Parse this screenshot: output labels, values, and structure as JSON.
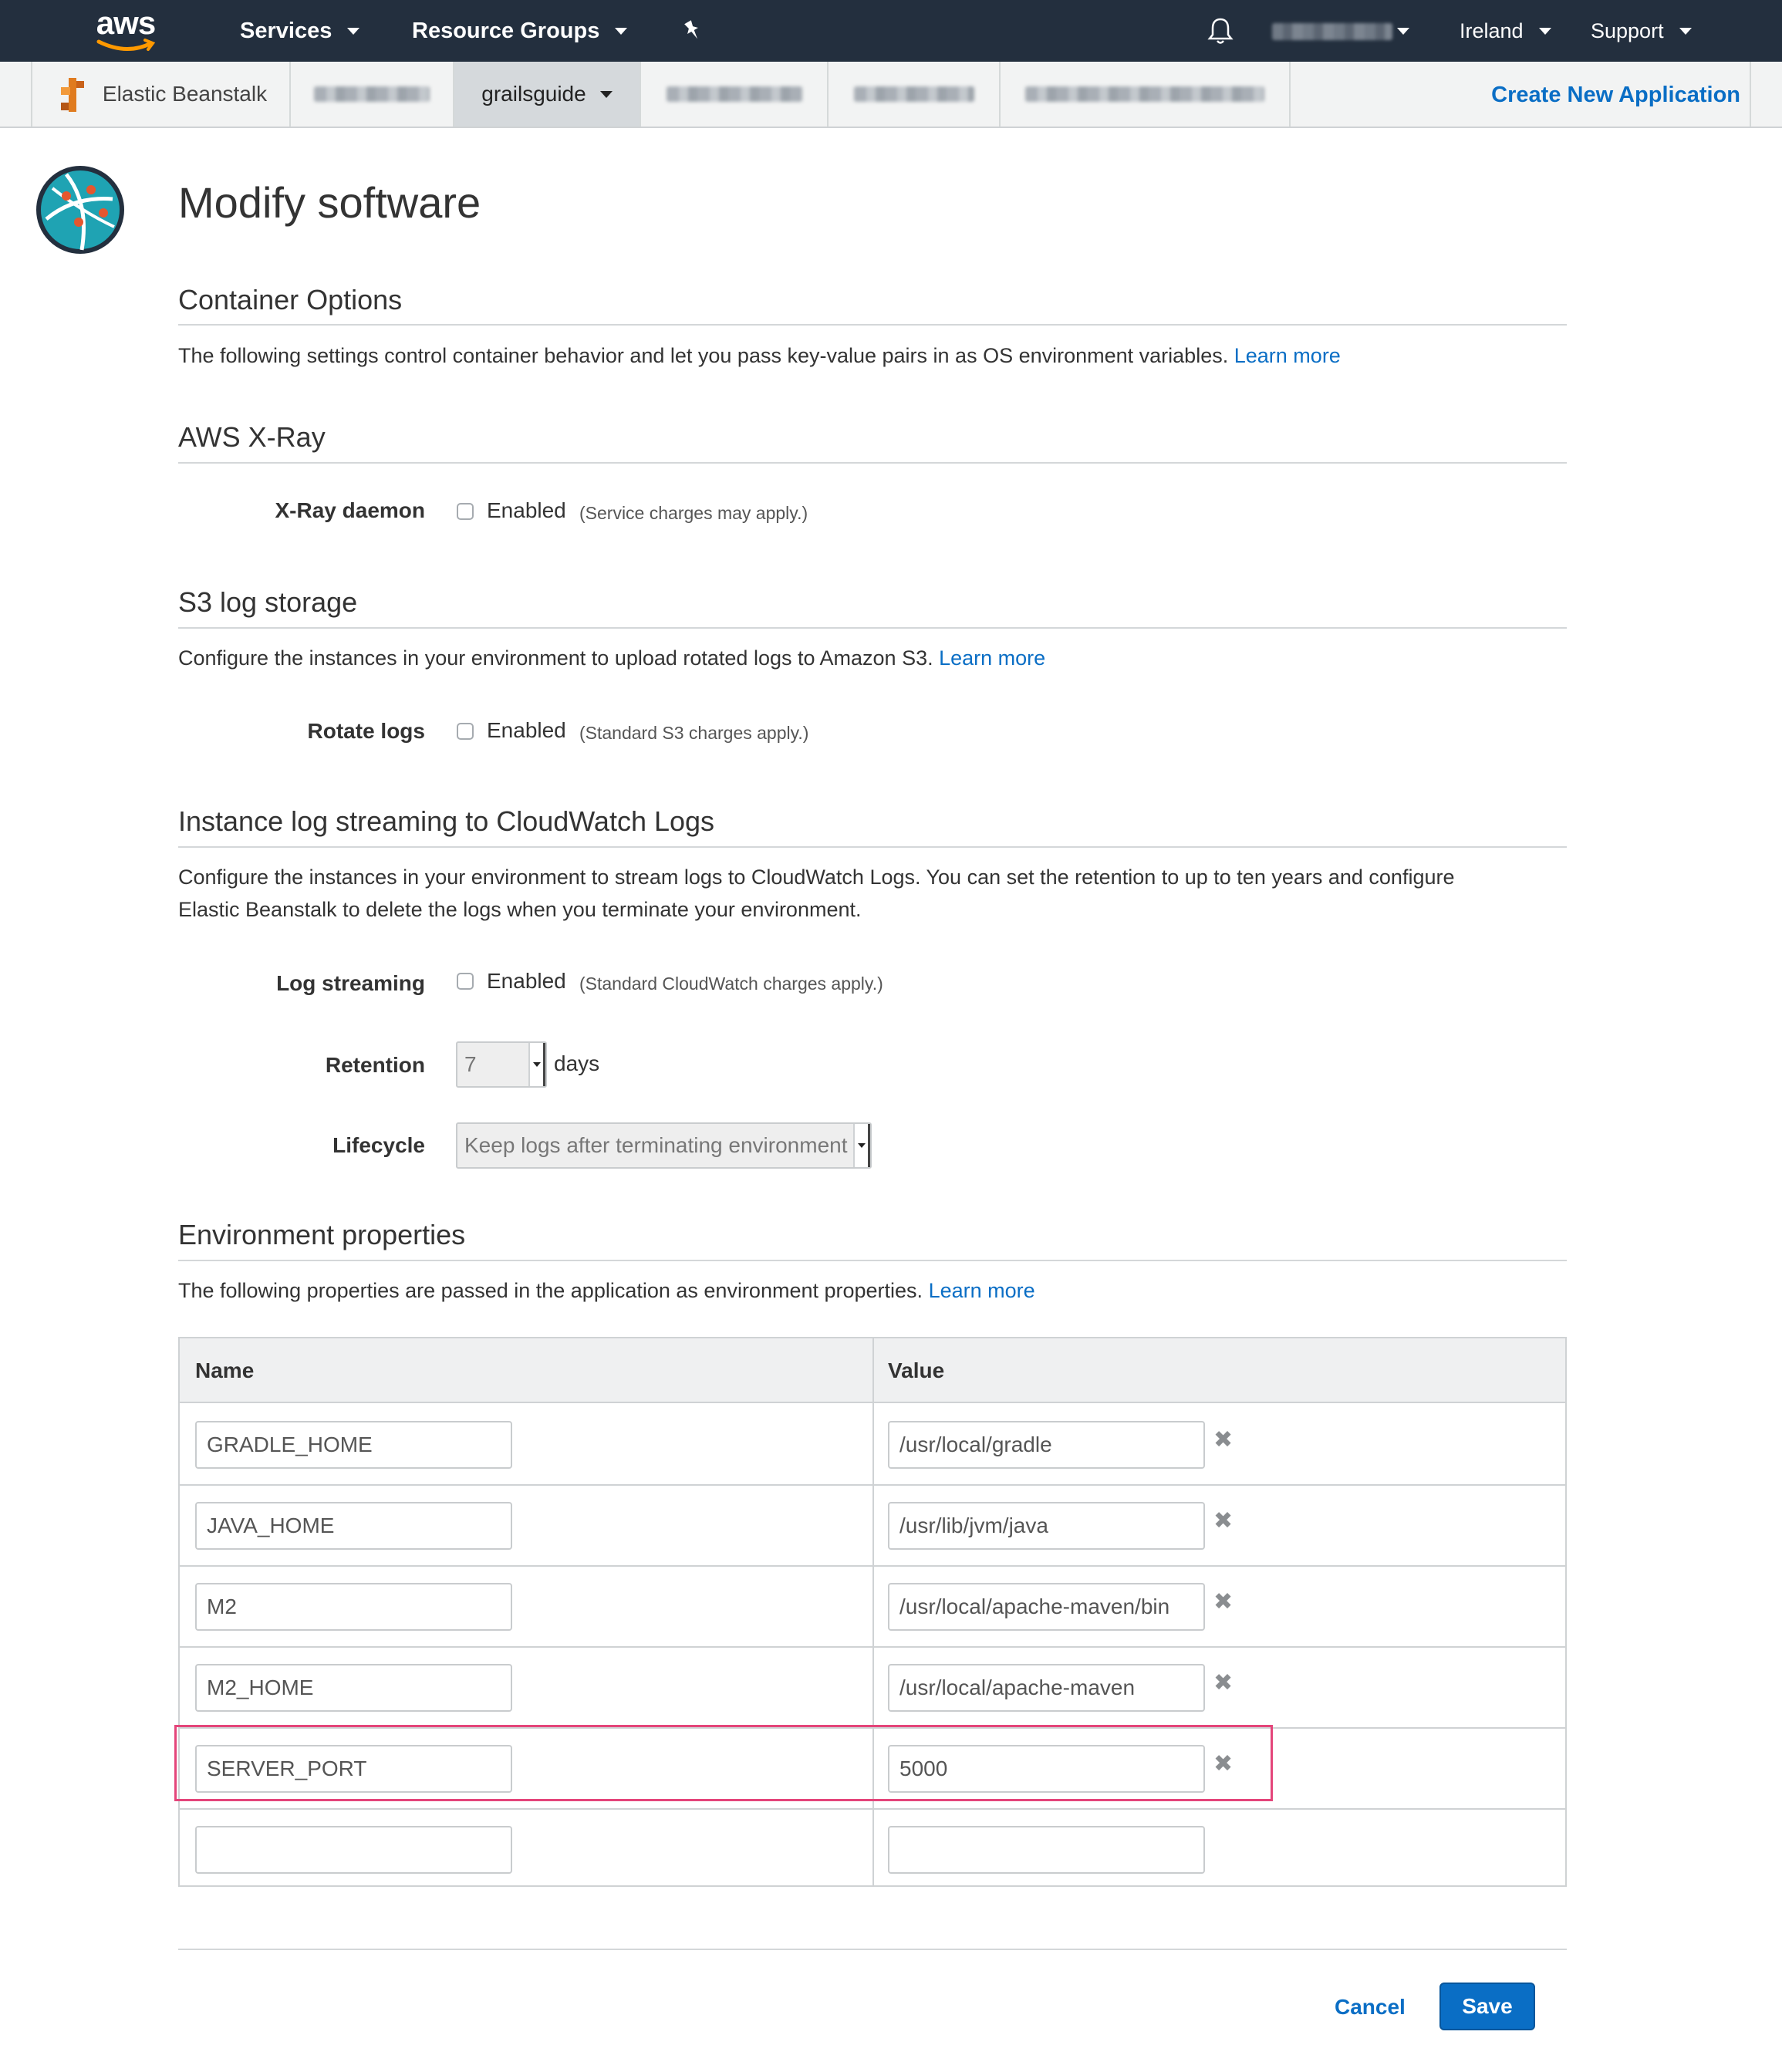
{
  "topnav": {
    "logo_text": "aws",
    "services_label": "Services",
    "resource_groups_label": "Resource Groups",
    "region_label": "Ireland",
    "support_label": "Support"
  },
  "subnav": {
    "service_name": "Elastic Beanstalk",
    "active_app": "grailsguide",
    "create_new_label": "Create New Application"
  },
  "page": {
    "title": "Modify software"
  },
  "container_options": {
    "title": "Container Options",
    "description": "The following settings control container behavior and let you pass key-value pairs in as OS environment variables.",
    "learn_more": "Learn more"
  },
  "xray": {
    "title": "AWS X-Ray",
    "label": "X-Ray daemon",
    "checkbox_label": "Enabled",
    "note": "(Service charges may apply.)"
  },
  "s3": {
    "title": "S3 log storage",
    "description": "Configure the instances in your environment to upload rotated logs to Amazon S3.",
    "learn_more": "Learn more",
    "label": "Rotate logs",
    "checkbox_label": "Enabled",
    "note": "(Standard S3 charges apply.)"
  },
  "cloudwatch": {
    "title": "Instance log streaming to CloudWatch Logs",
    "description_line1": "Configure the instances in your environment to stream logs to CloudWatch Logs. You can set the retention to up to ten years and configure",
    "description_line2": "Elastic Beanstalk to delete the logs when you terminate your environment.",
    "streaming_label": "Log streaming",
    "checkbox_label": "Enabled",
    "note": "(Standard CloudWatch charges apply.)",
    "retention_label": "Retention",
    "retention_value": "7",
    "retention_unit": "days",
    "lifecycle_label": "Lifecycle",
    "lifecycle_value": "Keep logs after terminating environment"
  },
  "env": {
    "title": "Environment properties",
    "description": "The following properties are passed in the application as environment properties.",
    "learn_more": "Learn more",
    "col_name": "Name",
    "col_value": "Value",
    "rows": [
      {
        "name": "GRADLE_HOME",
        "value": "/usr/local/gradle"
      },
      {
        "name": "JAVA_HOME",
        "value": "/usr/lib/jvm/java"
      },
      {
        "name": "M2",
        "value": "/usr/local/apache-maven/bin"
      },
      {
        "name": "M2_HOME",
        "value": "/usr/local/apache-maven"
      },
      {
        "name": "SERVER_PORT",
        "value": "5000"
      },
      {
        "name": "",
        "value": ""
      }
    ],
    "remove_icon": "✖"
  },
  "actions": {
    "cancel_label": "Cancel",
    "save_label": "Save"
  },
  "colors": {
    "nav_bg": "#232f3e",
    "link": "#0a6ec5",
    "highlight": "#e4457a",
    "primary_button": "#0a6ec5"
  },
  "icons": {
    "notifications": "bell-icon",
    "pin": "pin-icon",
    "service": "elastic-beanstalk-icon",
    "page": "network-globe-icon",
    "remove": "remove-x-icon"
  }
}
